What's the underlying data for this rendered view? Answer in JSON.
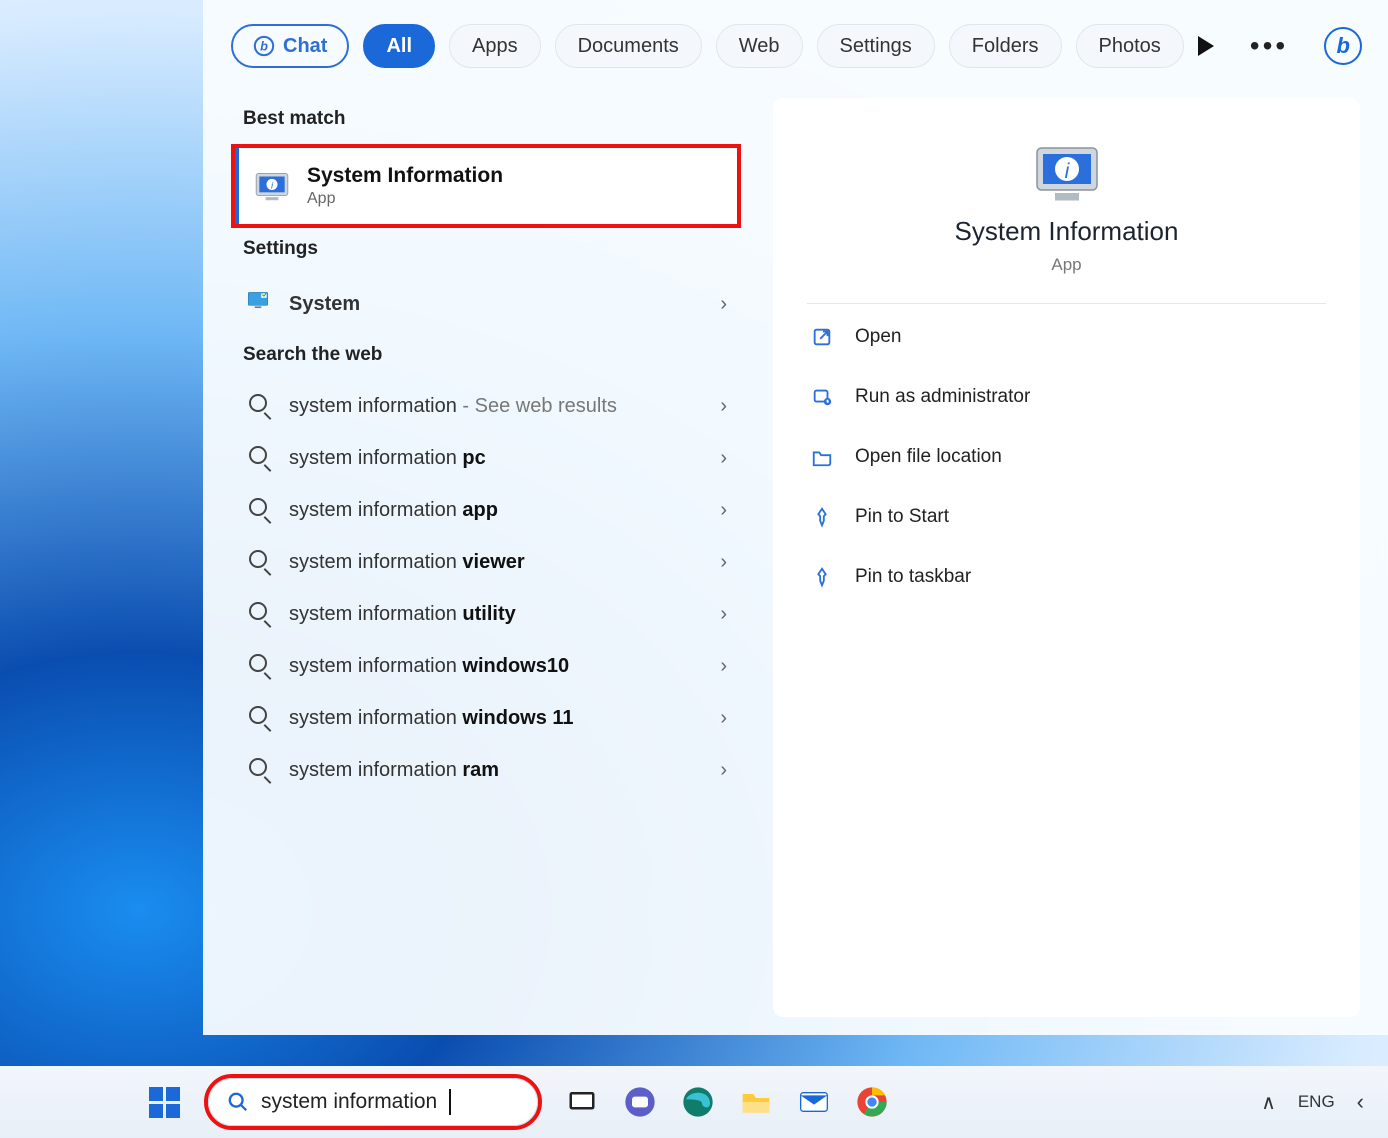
{
  "tabs": {
    "chat": "Chat",
    "items": [
      "All",
      "Apps",
      "Documents",
      "Web",
      "Settings",
      "Folders",
      "Photos"
    ],
    "active_index": 0
  },
  "left": {
    "best_match_header": "Best match",
    "best_match": {
      "title": "System Information",
      "subtitle": "App"
    },
    "settings_header": "Settings",
    "settings_item": "System",
    "web_header": "Search the web",
    "web_items": [
      {
        "prefix": "system information",
        "bold": "",
        "suffix": " - See web results"
      },
      {
        "prefix": "system information ",
        "bold": "pc",
        "suffix": ""
      },
      {
        "prefix": "system information ",
        "bold": "app",
        "suffix": ""
      },
      {
        "prefix": "system information ",
        "bold": "viewer",
        "suffix": ""
      },
      {
        "prefix": "system information ",
        "bold": "utility",
        "suffix": ""
      },
      {
        "prefix": "system information ",
        "bold": "windows10",
        "suffix": ""
      },
      {
        "prefix": "system information ",
        "bold": "windows 11",
        "suffix": ""
      },
      {
        "prefix": "system information ",
        "bold": "ram",
        "suffix": ""
      }
    ]
  },
  "detail": {
    "title": "System Information",
    "subtitle": "App",
    "actions": [
      "Open",
      "Run as administrator",
      "Open file location",
      "Pin to Start",
      "Pin to taskbar"
    ]
  },
  "taskbar": {
    "search_value": "system information",
    "lang": "ENG"
  }
}
